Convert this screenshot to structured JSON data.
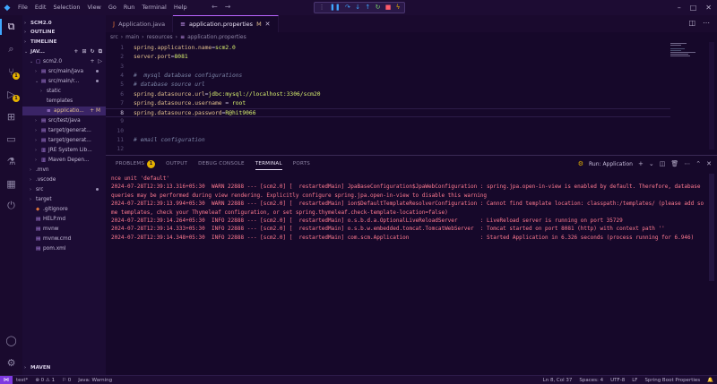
{
  "menu": [
    "File",
    "Edit",
    "Selection",
    "View",
    "Go",
    "Run",
    "Terminal",
    "Help"
  ],
  "window_controls": [
    "–",
    "□",
    "✕"
  ],
  "tabs": [
    {
      "label": "Application.java",
      "icon": "J",
      "active": false,
      "modified": ""
    },
    {
      "label": "application.properties",
      "icon": "≡",
      "active": true,
      "modified": "M"
    }
  ],
  "breadcrumb": [
    "src",
    "main",
    "resources",
    "application.properties"
  ],
  "sidebar": {
    "rows": [
      {
        "label": "SCM2.0",
        "section": true,
        "indent": 0,
        "chevron": "›"
      },
      {
        "label": "OUTLINE",
        "section": true,
        "indent": 0,
        "chevron": "›"
      },
      {
        "label": "TIMELINE",
        "section": true,
        "indent": 0,
        "chevron": "›"
      },
      {
        "label": "JAV...",
        "section": true,
        "indent": 0,
        "chevron": "⌄",
        "actions": "+ ⊞ ↻ ⧉"
      },
      {
        "label": "scm2.0",
        "indent": 1,
        "chevron": "⌄",
        "icon": "▢",
        "actions": "+ ▷"
      },
      {
        "label": "src/main/java",
        "indent": 2,
        "chevron": "›",
        "icon": "▤",
        "dot": true
      },
      {
        "label": "src/main/r...",
        "indent": 2,
        "chevron": "⌄",
        "icon": "▤",
        "dot": true
      },
      {
        "label": "static",
        "indent": 3,
        "chevron": "›"
      },
      {
        "label": "templates",
        "indent": 3,
        "chevron": ""
      },
      {
        "label": "applicatio...",
        "indent": 3,
        "chevron": "",
        "icon": "≡",
        "selected": true,
        "mod": "+ M"
      },
      {
        "label": "src/test/java",
        "indent": 2,
        "chevron": "›",
        "icon": "▤"
      },
      {
        "label": "target/generat...",
        "indent": 2,
        "chevron": "›",
        "icon": "▤"
      },
      {
        "label": "target/generat...",
        "indent": 2,
        "chevron": "›",
        "icon": "▤"
      },
      {
        "label": "JRE System Lib...",
        "indent": 2,
        "chevron": "›",
        "icon": "▥"
      },
      {
        "label": "Maven Depen...",
        "indent": 2,
        "chevron": "›",
        "icon": "▥"
      },
      {
        "label": ".mvn",
        "indent": 1,
        "chevron": "›"
      },
      {
        "label": ".vscode",
        "indent": 1,
        "chevron": "›"
      },
      {
        "label": "src",
        "indent": 1,
        "chevron": "›",
        "dot": true
      },
      {
        "label": "target",
        "indent": 1,
        "chevron": "›"
      },
      {
        "label": ".gitignore",
        "indent": 1,
        "chevron": "",
        "icon": "◆"
      },
      {
        "label": "HELP.md",
        "indent": 1,
        "chevron": "",
        "icon": "▤"
      },
      {
        "label": "mvnw",
        "indent": 1,
        "chevron": "",
        "icon": "▤"
      },
      {
        "label": "mvnw.cmd",
        "indent": 1,
        "chevron": "",
        "icon": "▤"
      },
      {
        "label": "pom.xml",
        "indent": 1,
        "chevron": "",
        "icon": "▤"
      }
    ],
    "bottom": "MAVEN"
  },
  "editor": {
    "lines": [
      {
        "n": "1",
        "parts": [
          {
            "t": "spring.application.name",
            "c": "k"
          },
          {
            "t": "=",
            "c": "p"
          },
          {
            "t": "scm2.0",
            "c": "v"
          }
        ]
      },
      {
        "n": "2",
        "parts": [
          {
            "t": "server.port",
            "c": "k"
          },
          {
            "t": "=",
            "c": "p"
          },
          {
            "t": "8081",
            "c": "v"
          }
        ]
      },
      {
        "n": "3",
        "parts": []
      },
      {
        "n": "4",
        "parts": [
          {
            "t": "#  mysql database configurations",
            "c": "cm"
          }
        ]
      },
      {
        "n": "5",
        "parts": [
          {
            "t": "# database source url",
            "c": "cm"
          }
        ]
      },
      {
        "n": "6",
        "parts": [
          {
            "t": "spring.datasource.url",
            "c": "k"
          },
          {
            "t": "=",
            "c": "p"
          },
          {
            "t": "jdbc:mysql://localhost:3306/scm20",
            "c": "v"
          }
        ]
      },
      {
        "n": "7",
        "parts": [
          {
            "t": "spring.datasource.username",
            "c": "k"
          },
          {
            "t": " = ",
            "c": "p"
          },
          {
            "t": "root",
            "c": "v"
          }
        ]
      },
      {
        "n": "8",
        "parts": [
          {
            "t": "spring.datasource.password",
            "c": "k"
          },
          {
            "t": "=",
            "c": "p"
          },
          {
            "t": "R@hit9066",
            "c": "v"
          }
        ],
        "current": true
      },
      {
        "n": "9",
        "parts": []
      },
      {
        "n": "10",
        "parts": []
      },
      {
        "n": "11",
        "parts": [
          {
            "t": "# email configuration",
            "c": "cm"
          }
        ]
      },
      {
        "n": "12",
        "parts": []
      }
    ]
  },
  "panel": {
    "tabs": [
      {
        "label": "PROBLEMS",
        "badge": "1"
      },
      {
        "label": "OUTPUT"
      },
      {
        "label": "DEBUG CONSOLE"
      },
      {
        "label": "TERMINAL",
        "active": true
      },
      {
        "label": "PORTS"
      }
    ],
    "run_label": "Run: Application",
    "terminal_lines": [
      "nce unit 'default'",
      "2024-07-28T12:39:13.316+05:30  WARN 22888 --- [scm2.0] [  restartedMain] JpaBaseConfiguration$JpaWebConfiguration : spring.jpa.open-in-view is enabled by default. Therefore, database queries may be performed during view rendering. Explicitly configure spring.jpa.open-in-view to disable this warning",
      "2024-07-28T12:39:13.994+05:30  WARN 22888 --- [scm2.0] [  restartedMain] ion$DefaultTemplateResolverConfiguration : Cannot find template location: classpath:/templates/ (please add some templates, check your Thymeleaf configuration, or set spring.thymeleaf.check-template-location=false)",
      "2024-07-28T12:39:14.264+05:30  INFO 22888 --- [scm2.0] [  restartedMain] o.s.b.d.a.OptionalLiveReloadServer       : LiveReload server is running on port 35729",
      "2024-07-28T12:39:14.333+05:30  INFO 22888 --- [scm2.0] [  restartedMain] o.s.b.w.embedded.tomcat.TomcatWebServer  : Tomcat started on port 8081 (http) with context path ''",
      "2024-07-28T12:39:14.348+05:30  INFO 22888 --- [scm2.0] [  restartedMain] com.scm.Application                      : Started Application in 6.326 seconds (process running for 6.946)"
    ]
  },
  "statusbar": {
    "left": [
      "test*",
      "⊗ 0 ⚠ 1",
      "⚐ 0",
      "Java: Warning"
    ],
    "right": [
      "Ln 8, Col 37",
      "Spaces: 4",
      "UTF-8",
      "LF",
      "Spring Boot Properties",
      "🔔"
    ]
  },
  "colors": {
    "accent": "#bb66ff",
    "background": "#16082a",
    "terminal_text": "#ff7a90",
    "key": "#e2c08d",
    "value": "#d8f06e"
  }
}
